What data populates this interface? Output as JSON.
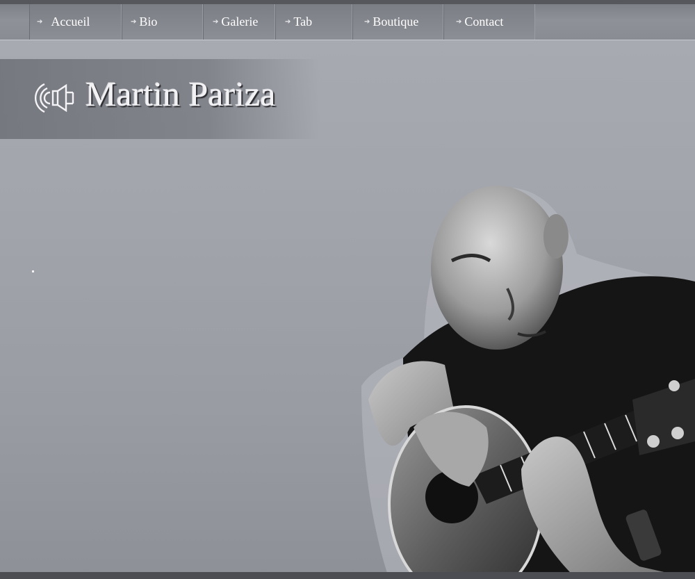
{
  "nav": {
    "items": [
      {
        "label": "Accueil",
        "icon": "arrow-right-icon"
      },
      {
        "label": "Bio",
        "icon": "arrow-right-icon"
      },
      {
        "label": "Galerie",
        "icon": "arrow-right-icon"
      },
      {
        "label": "Tab",
        "icon": "arrow-right-icon"
      },
      {
        "label": "Boutique",
        "icon": "arrow-right-icon"
      },
      {
        "label": "Contact",
        "icon": "arrow-right-icon"
      }
    ],
    "arrow_glyph": "➔"
  },
  "header": {
    "title": "Martin Pariza",
    "logo_icon": "speaker-sound-icon"
  },
  "hero": {
    "image": "guitarist-photo"
  },
  "colors": {
    "background": "#a3a5ad",
    "nav": "#868890",
    "title_text": "#f2f2f4",
    "shirt": "#141414"
  }
}
